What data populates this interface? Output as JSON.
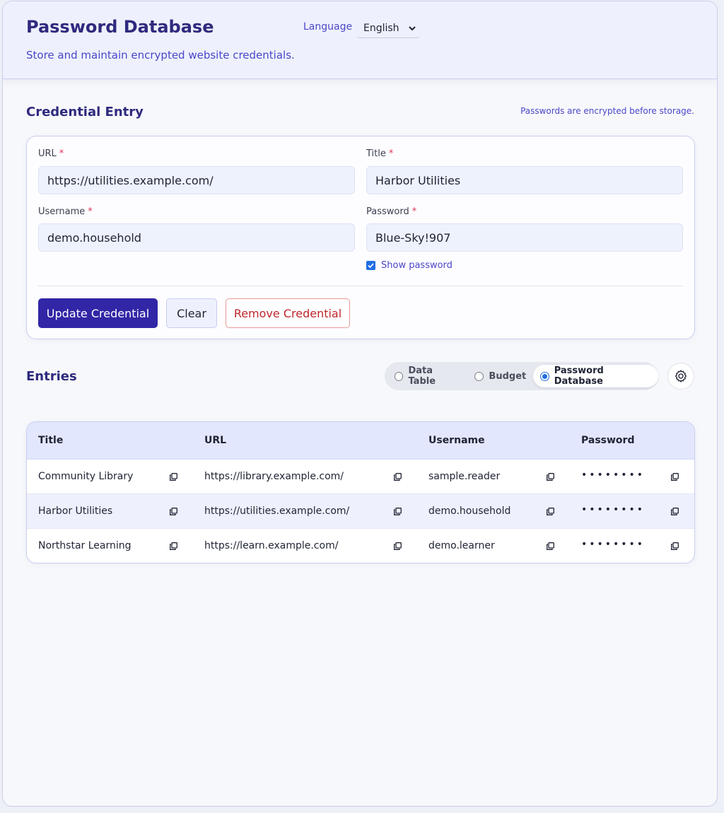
{
  "header": {
    "title": "Password Database",
    "subtitle": "Store and maintain encrypted website credentials.",
    "language_label": "Language",
    "language_value": "English"
  },
  "entry": {
    "section_title": "Credential Entry",
    "note": "Passwords are encrypted before storage.",
    "url_label": "URL",
    "url_value": "https://utilities.example.com/",
    "title_label": "Title",
    "title_value": "Harbor Utilities",
    "username_label": "Username",
    "username_value": "demo.household",
    "password_label": "Password",
    "password_value": "Blue-Sky!907",
    "required_mark": "*",
    "show_password_label": "Show password",
    "show_password_checked": true,
    "update_label": "Update Credential",
    "clear_label": "Clear",
    "remove_label": "Remove Credential"
  },
  "entries": {
    "section_title": "Entries",
    "modes": [
      "Data Table",
      "Budget",
      "Password Database"
    ],
    "active_mode": "Password Database",
    "columns": [
      "Title",
      "URL",
      "Username",
      "Password"
    ],
    "rows": [
      {
        "title": "Community Library",
        "url": "https://library.example.com/",
        "username": "sample.reader",
        "password": "••••••••"
      },
      {
        "title": "Harbor Utilities",
        "url": "https://utilities.example.com/",
        "username": "demo.household",
        "password": "••••••••"
      },
      {
        "title": "Northstar Learning",
        "url": "https://learn.example.com/",
        "username": "demo.learner",
        "password": "••••••••"
      }
    ]
  },
  "colors": {
    "accent": "#3126a6",
    "heading": "#2f2a7e",
    "link": "#4b46c9",
    "danger": "#c0262d",
    "required": "#e0345a"
  }
}
